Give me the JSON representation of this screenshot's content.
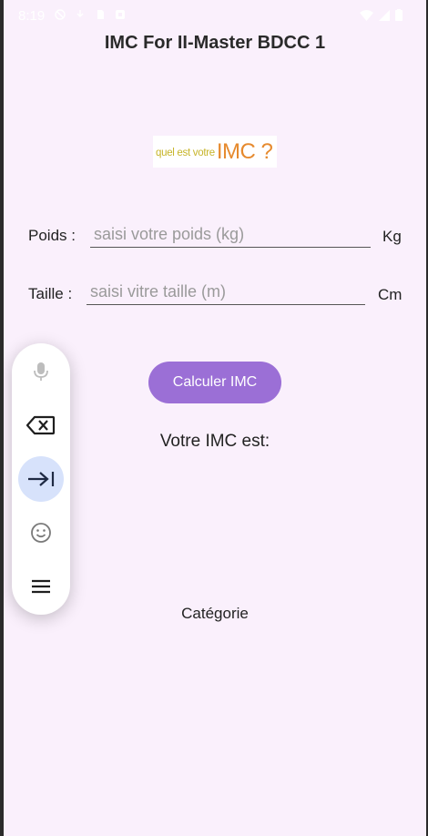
{
  "status_bar": {
    "time": "8:19"
  },
  "app": {
    "title": "IMC For II-Master BDCC 1"
  },
  "logo": {
    "small_text": "quel est votre",
    "big_text": "IMC ?"
  },
  "form": {
    "weight": {
      "label": "Poids :",
      "placeholder": "saisi votre poids (kg)",
      "value": "",
      "unit": "Kg"
    },
    "height": {
      "label": "Taille :",
      "placeholder": "saisi vitre taille (m)",
      "value": "",
      "unit": "Cm"
    }
  },
  "actions": {
    "calculate_label": "Calculer IMC"
  },
  "result": {
    "label": "Votre IMC est:",
    "category_label": "Catégorie"
  },
  "input_toolbar": {
    "items": [
      "microphone-icon",
      "backspace-icon",
      "tab-icon",
      "emoji-icon",
      "menu-icon"
    ],
    "active_item": "tab-icon"
  },
  "colors": {
    "background": "#faf0fc",
    "accent": "#9b6fd6",
    "toolbar_active": "#d7e2fb"
  }
}
